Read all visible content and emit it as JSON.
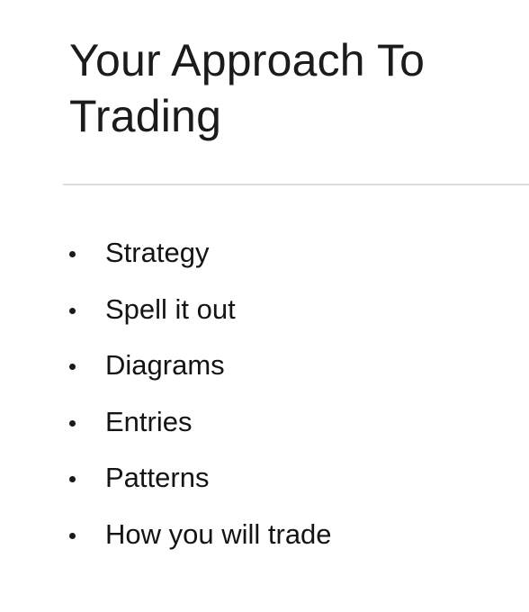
{
  "slide": {
    "title_lines": [
      "Your Approach To",
      "Trading"
    ],
    "bullets": [
      "Strategy",
      "Spell it out",
      "Diagrams",
      "Entries",
      "Patterns",
      "How you will trade"
    ]
  }
}
